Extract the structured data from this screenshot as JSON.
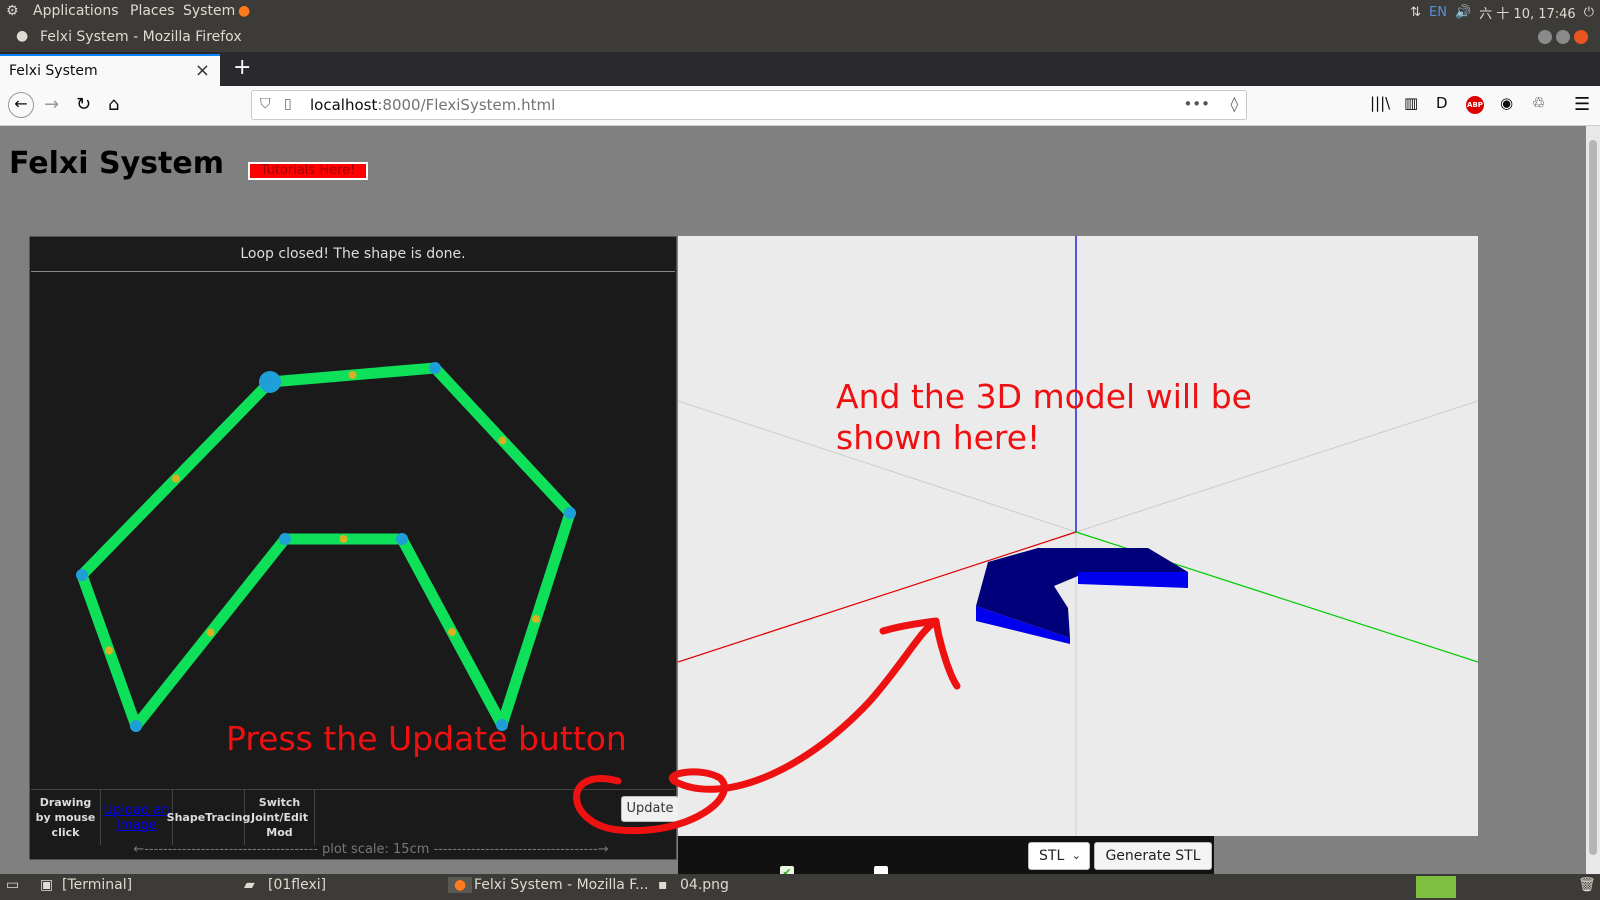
{
  "panel": {
    "menus": [
      "Applications",
      "Places",
      "System"
    ],
    "lang": "EN",
    "clock": "六 十 10, 17:46"
  },
  "window": {
    "title": "Felxi System - Mozilla Firefox"
  },
  "browser": {
    "tab_title": "Felxi System",
    "url_host": "localhost",
    "url_path": ":8000/FlexiSystem.html"
  },
  "page": {
    "title": "Felxi System",
    "tutorial_button": "Tutorials Here!",
    "draw_status": "Loop closed! The shape is done.",
    "controls": {
      "draw_mode": "Drawing by mouse click",
      "upload": "Upload an image",
      "tracing": "ShapeTracing",
      "switch_mode": "Switch Joint/Edit Mod",
      "update": "Update"
    },
    "plot_scale": "←------------------------------------- plot scale: 15cm -----------------------------------→",
    "export_format": "STL",
    "generate_button": "Generate STL"
  },
  "annotations": {
    "update_hint": "Press the Update button",
    "model_hint": "And the 3D model will be shown here!"
  },
  "taskbar": {
    "items": [
      "[Terminal]",
      "[01flexi]",
      "Felxi System - Mozilla F...",
      "04.png"
    ]
  },
  "colors": {
    "shape_line": "#0ee05a",
    "joint": "#1e9fd8",
    "midpoint": "#d8b020",
    "annotation": "#ee1111",
    "model_top": "#00007a",
    "model_side": "#0000ee"
  }
}
